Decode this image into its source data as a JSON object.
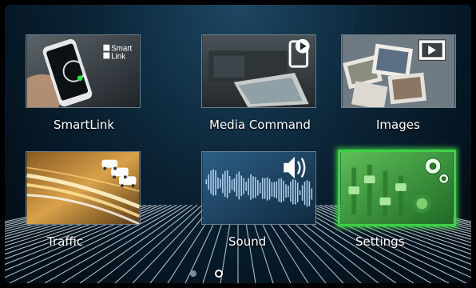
{
  "menu": {
    "items": [
      {
        "label": "SmartLink",
        "icon": "smartlink-icon",
        "badge_text": "Smart Link"
      },
      {
        "label": "Media Command",
        "icon": "media-command-icon"
      },
      {
        "label": "Images",
        "icon": "images-icon"
      },
      {
        "label": "Traffic",
        "icon": "traffic-icon"
      },
      {
        "label": "Sound",
        "icon": "sound-icon"
      },
      {
        "label": "Settings",
        "icon": "settings-icon",
        "selected": true
      }
    ]
  },
  "pager": {
    "page_count": 2,
    "current_page": 2
  },
  "colors": {
    "selection_highlight": "#3fd047",
    "background_top": "#1d4763",
    "background_bottom": "#03101a"
  }
}
